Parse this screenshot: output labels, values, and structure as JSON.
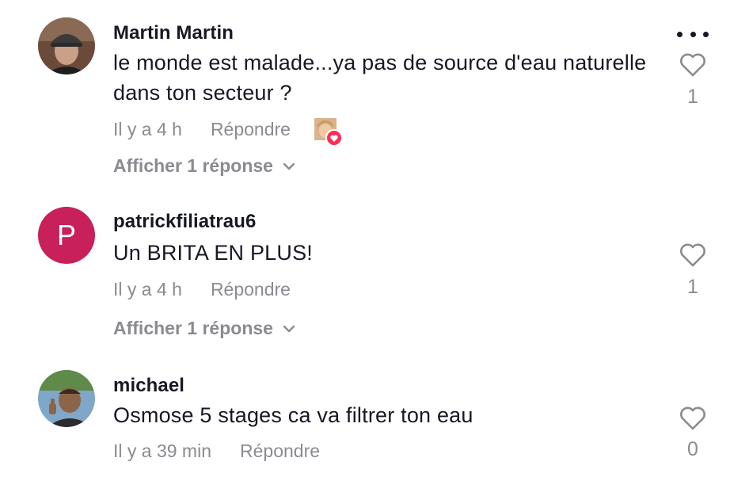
{
  "comments": [
    {
      "username": "Martin Martin",
      "text": "le monde est malade...ya pas de source d'eau naturelle dans ton secteur ?",
      "time": "Il y a 4 h",
      "reply_label": "Répondre",
      "view_replies": "Afficher 1 réponse",
      "likes": "1",
      "avatar_icon": "user-photo-cap",
      "liked_by_creator": true
    },
    {
      "username": "patrickfiliatrau6",
      "text": "Un BRITA EN PLUS!",
      "time": "Il y a 4 h",
      "reply_label": "Répondre",
      "view_replies": "Afficher 1 réponse",
      "likes": "1",
      "avatar_letter": "P",
      "avatar_color": "#c8205a"
    },
    {
      "username": "michael",
      "text": "Osmose 5 stages ca va filtrer ton eau",
      "time": "Il y a 39 min",
      "reply_label": "Répondre",
      "likes": "0",
      "avatar_icon": "user-photo-thumbsup"
    }
  ],
  "colors": {
    "text": "#161823",
    "muted": "#8a8b91",
    "heart_badge": "#fe2c55"
  }
}
